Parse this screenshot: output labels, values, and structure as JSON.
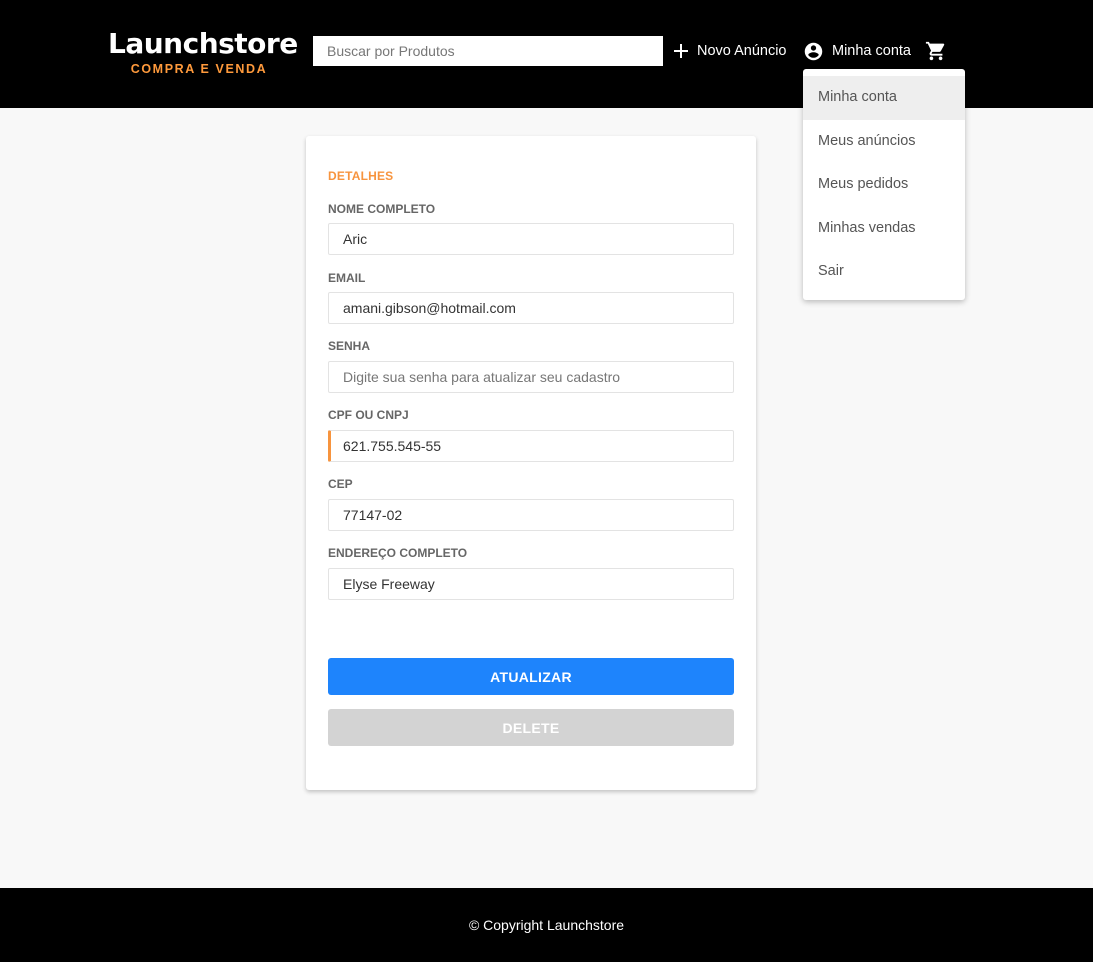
{
  "header": {
    "logo_title": "Launchstore",
    "logo_subtitle": "COMPRA E VENDA",
    "search_placeholder": "Buscar por Produtos",
    "new_ad_label": "Novo Anúncio",
    "account_label": "Minha conta",
    "icons": {
      "new_ad": "plus-icon",
      "account": "account-circle-icon",
      "cart": "shopping-cart-icon"
    }
  },
  "account_menu": {
    "items": [
      {
        "label": "Minha conta",
        "active": true
      },
      {
        "label": "Meus anúncios",
        "active": false
      },
      {
        "label": "Meus pedidos",
        "active": false
      },
      {
        "label": "Minhas vendas",
        "active": false
      },
      {
        "label": "Sair",
        "active": false
      }
    ]
  },
  "form": {
    "section_title": "DETALHES",
    "fields": [
      {
        "label": "NOME COMPLETO",
        "value": "Aric",
        "placeholder": ""
      },
      {
        "label": "EMAIL",
        "value": "amani.gibson@hotmail.com",
        "placeholder": ""
      },
      {
        "label": "SENHA",
        "value": "",
        "placeholder": "Digite sua senha para atualizar seu cadastro"
      },
      {
        "label": "CPF OU CNPJ",
        "value": "621.755.545-55",
        "placeholder": "",
        "focused": true
      },
      {
        "label": "CEP",
        "value": "77147-02",
        "placeholder": ""
      },
      {
        "label": "ENDEREÇO COMPLETO",
        "value": "Elyse Freeway",
        "placeholder": ""
      }
    ],
    "update_button": "ATUALIZAR",
    "delete_button": "DELETE"
  },
  "footer": {
    "copyright": "© Copyright Launchstore"
  },
  "colors": {
    "accent": "#f7943e",
    "primary": "#1e84fc",
    "header_bg": "#000000",
    "disabled": "#d3d3d3"
  }
}
